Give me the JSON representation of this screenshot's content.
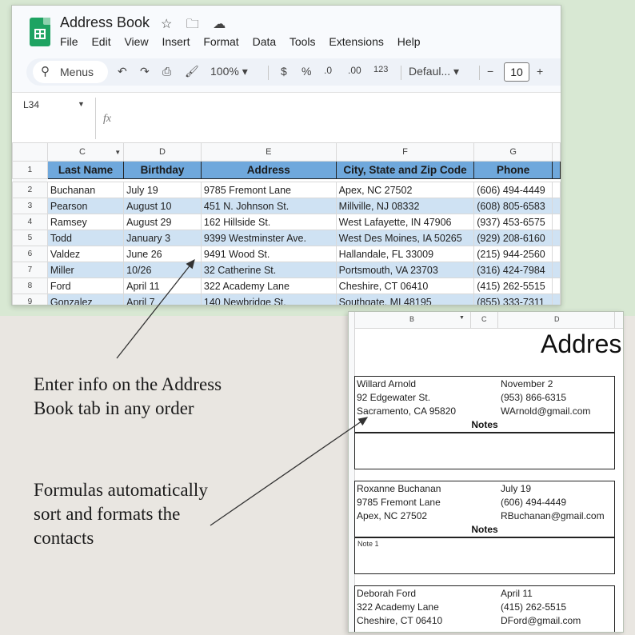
{
  "app": {
    "title": "Address Book",
    "title_icons": [
      "star-icon",
      "folder-move-icon",
      "cloud-status-icon"
    ],
    "menu": [
      "File",
      "Edit",
      "View",
      "Insert",
      "Format",
      "Data",
      "Tools",
      "Extensions",
      "Help"
    ]
  },
  "toolbar": {
    "search_label": "Menus",
    "zoom": "100%",
    "currency": "$",
    "percent": "%",
    "decrease_decimal": ".0",
    "increase_decimal": ".00",
    "number_format": "123",
    "font": "Defaul...",
    "font_size": "10",
    "minus": "−",
    "plus": "+"
  },
  "formula_bar": {
    "cell_ref": "L34",
    "fx": "fx"
  },
  "sheet": {
    "columns": [
      "C",
      "D",
      "E",
      "F",
      "G"
    ],
    "headers": [
      "Last Name",
      "Birthday",
      "Address",
      "City, State and Zip Code",
      "Phone"
    ],
    "header_row_number": "1",
    "rows": [
      {
        "n": "2",
        "cells": [
          "Buchanan",
          "July 19",
          "9785 Fremont Lane",
          "Apex, NC 27502",
          "(606) 494-4449"
        ]
      },
      {
        "n": "3",
        "cells": [
          "Pearson",
          "August 10",
          "451 N. Johnson St.",
          "Millville, NJ 08332",
          "(608) 805-6583"
        ]
      },
      {
        "n": "4",
        "cells": [
          "Ramsey",
          "August 29",
          "162 Hillside St.",
          "West Lafayette, IN 47906",
          "(937) 453-6575"
        ]
      },
      {
        "n": "5",
        "cells": [
          "Todd",
          "January 3",
          "9399 Westminster Ave.",
          "West Des Moines, IA 50265",
          "(929) 208-6160"
        ]
      },
      {
        "n": "6",
        "cells": [
          "Valdez",
          "June 26",
          "9491 Wood St.",
          "Hallandale, FL 33009",
          "(215) 944-2560"
        ]
      },
      {
        "n": "7",
        "cells": [
          "Miller",
          "10/26",
          "32 Catherine St.",
          "Portsmouth, VA 23703",
          "(316) 424-7984"
        ]
      },
      {
        "n": "8",
        "cells": [
          "Ford",
          "April 11",
          "322 Academy Lane",
          "Cheshire, CT 06410",
          "(415) 262-5515"
        ]
      },
      {
        "n": "9",
        "cells": [
          "Gonzalez",
          "April 7",
          "140 Newbridge St.",
          "Southgate, MI 48195",
          "(855) 333-7311"
        ]
      }
    ]
  },
  "sheet2": {
    "columns": [
      "B",
      "C",
      "D"
    ],
    "title": "Addres",
    "notes_label": "Notes",
    "cards": [
      {
        "name": "Willard Arnold",
        "date": "November 2",
        "street": "92 Edgewater St.",
        "phone": "(953) 866-6315",
        "city": "Sacramento, CA 95820",
        "email": "WArnold@gmail.com",
        "note": ""
      },
      {
        "name": "Roxanne Buchanan",
        "date": "July 19",
        "street": "9785 Fremont Lane",
        "phone": "(606) 494-4449",
        "city": "Apex, NC 27502",
        "email": "RBuchanan@gmail.com",
        "note": "Note 1"
      },
      {
        "name": "Deborah Ford",
        "date": "April 11",
        "street": "322 Academy Lane",
        "phone": "(415) 262-5515",
        "city": "Cheshire, CT 06410",
        "email": "DFord@gmail.com",
        "note": ""
      }
    ]
  },
  "captions": {
    "first": [
      "Enter info on the Address",
      "Book tab in any order"
    ],
    "second": [
      "Formulas automatically",
      "sort and formats the",
      "contacts"
    ]
  }
}
